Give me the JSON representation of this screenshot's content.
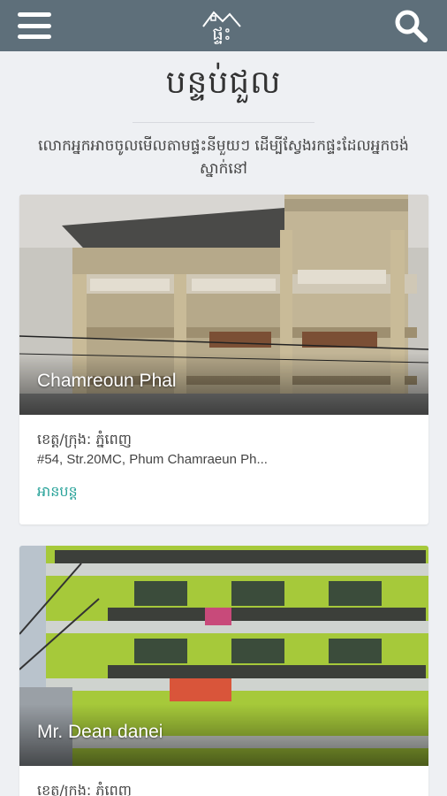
{
  "header": {
    "logo_text": "ផ្ទះ",
    "menu_icon": "hamburger-menu-icon",
    "search_icon": "search-icon",
    "bar_color": "#5e6f7a"
  },
  "page": {
    "title": "បន្ទប់ជួល",
    "intro": "លោកអ្នកអាចចូលមើលតាមផ្ទះនីមួយៗ ដើម្បីស្វែងរកផ្ទះដែលអ្នកចង់ស្នាក់នៅ"
  },
  "listings": [
    {
      "name": "Chamreoun Phal",
      "province": "ខេត្ត/ក្រុង: ភ្នំពេញ",
      "address": "#54, Str.20MC, Phum Chamraeun Ph...",
      "read_more": "អានបន្ត"
    },
    {
      "name": "Mr. Dean danei",
      "province": "ខេត្ត/ក្រុង: ភ្នំពេញ"
    }
  ],
  "colors": {
    "accent": "#2aa39a",
    "background": "#eef0f3"
  }
}
